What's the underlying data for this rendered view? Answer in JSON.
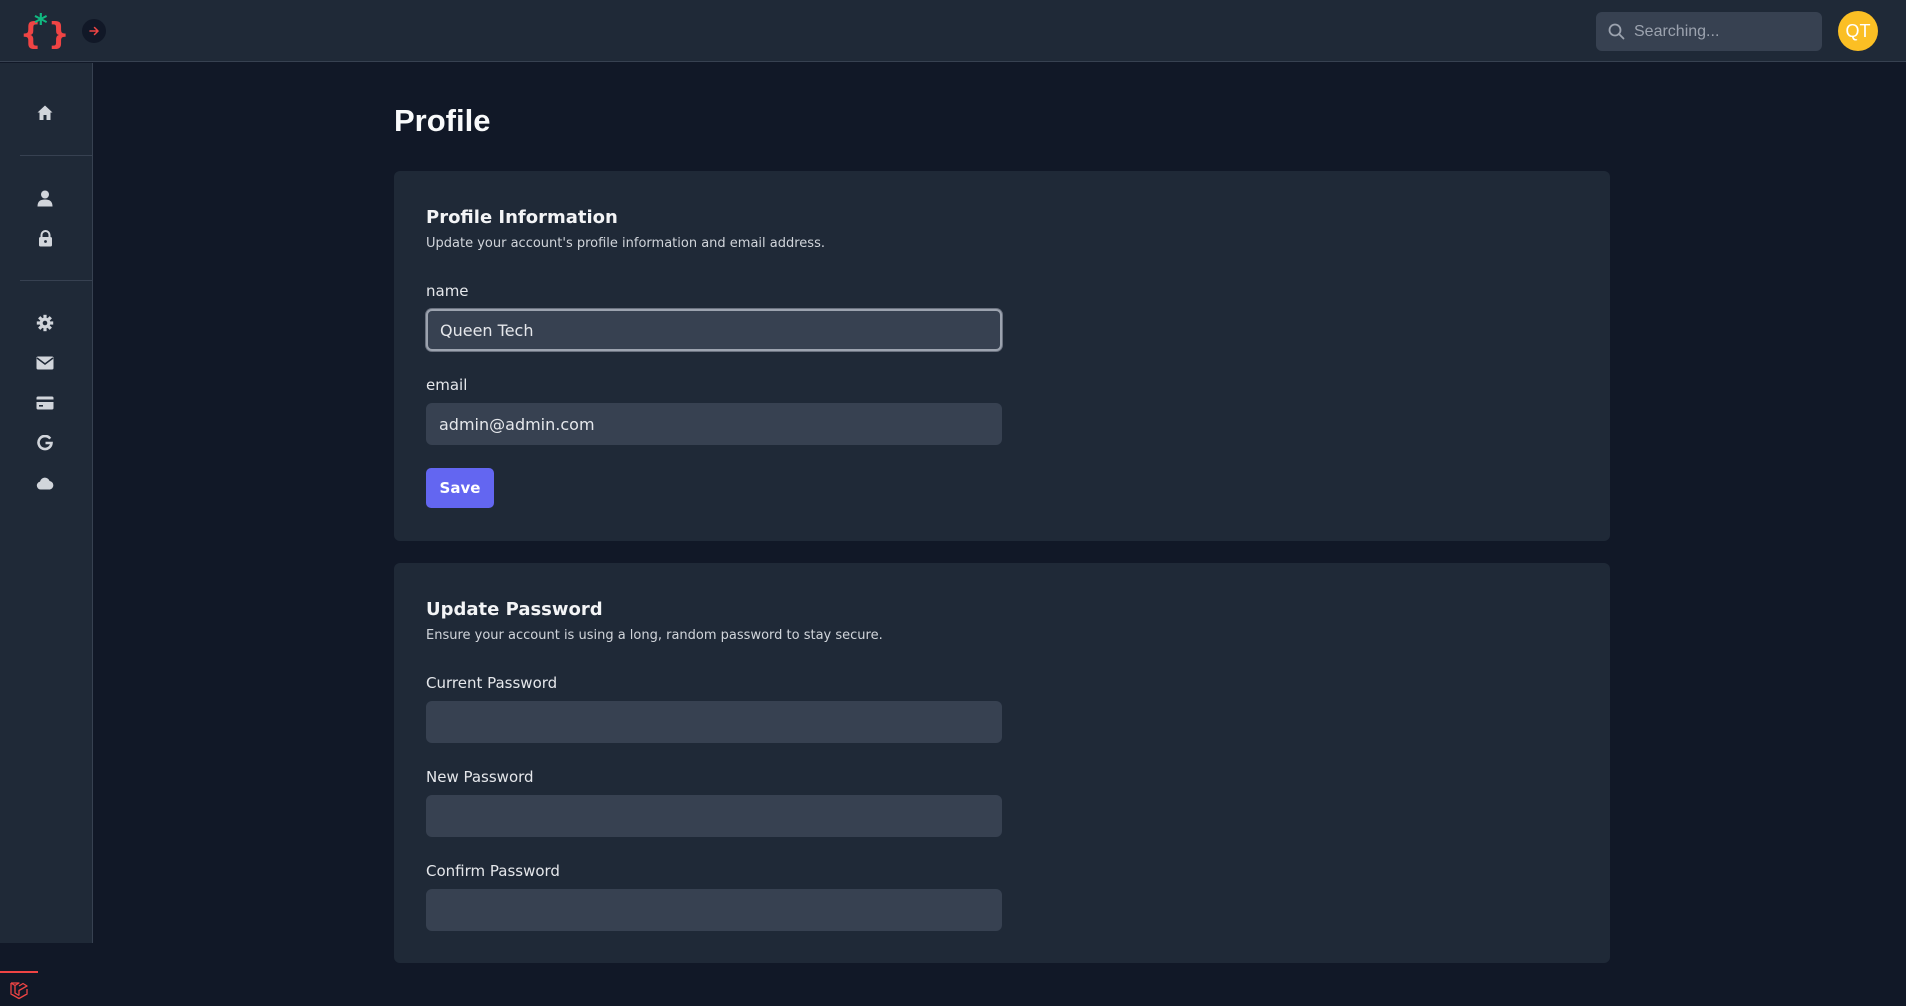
{
  "header": {
    "search": {
      "placeholder": "Searching..."
    },
    "avatar_initials": "QT"
  },
  "page": {
    "title": "Profile"
  },
  "profile_info": {
    "title": "Profile Information",
    "description": "Update your account's profile information and email address.",
    "name_label": "name",
    "name_value": "Queen Tech",
    "email_label": "email",
    "email_value": "admin@admin.com",
    "save_label": "Save"
  },
  "update_password": {
    "title": "Update Password",
    "description": "Ensure your account is using a long, random password to stay secure.",
    "current_label": "Current Password",
    "new_label": "New Password",
    "confirm_label": "Confirm Password"
  },
  "sidebar": {
    "icons": [
      "home-icon",
      "user-icon",
      "lock-icon",
      "gear-icon",
      "mail-icon",
      "credit-card-icon",
      "google-icon",
      "cloud-icon"
    ]
  },
  "colors": {
    "accent": "#6366f1",
    "avatar": "#fbbf24",
    "logo_red": "#ef4444",
    "logo_green": "#10b981"
  }
}
